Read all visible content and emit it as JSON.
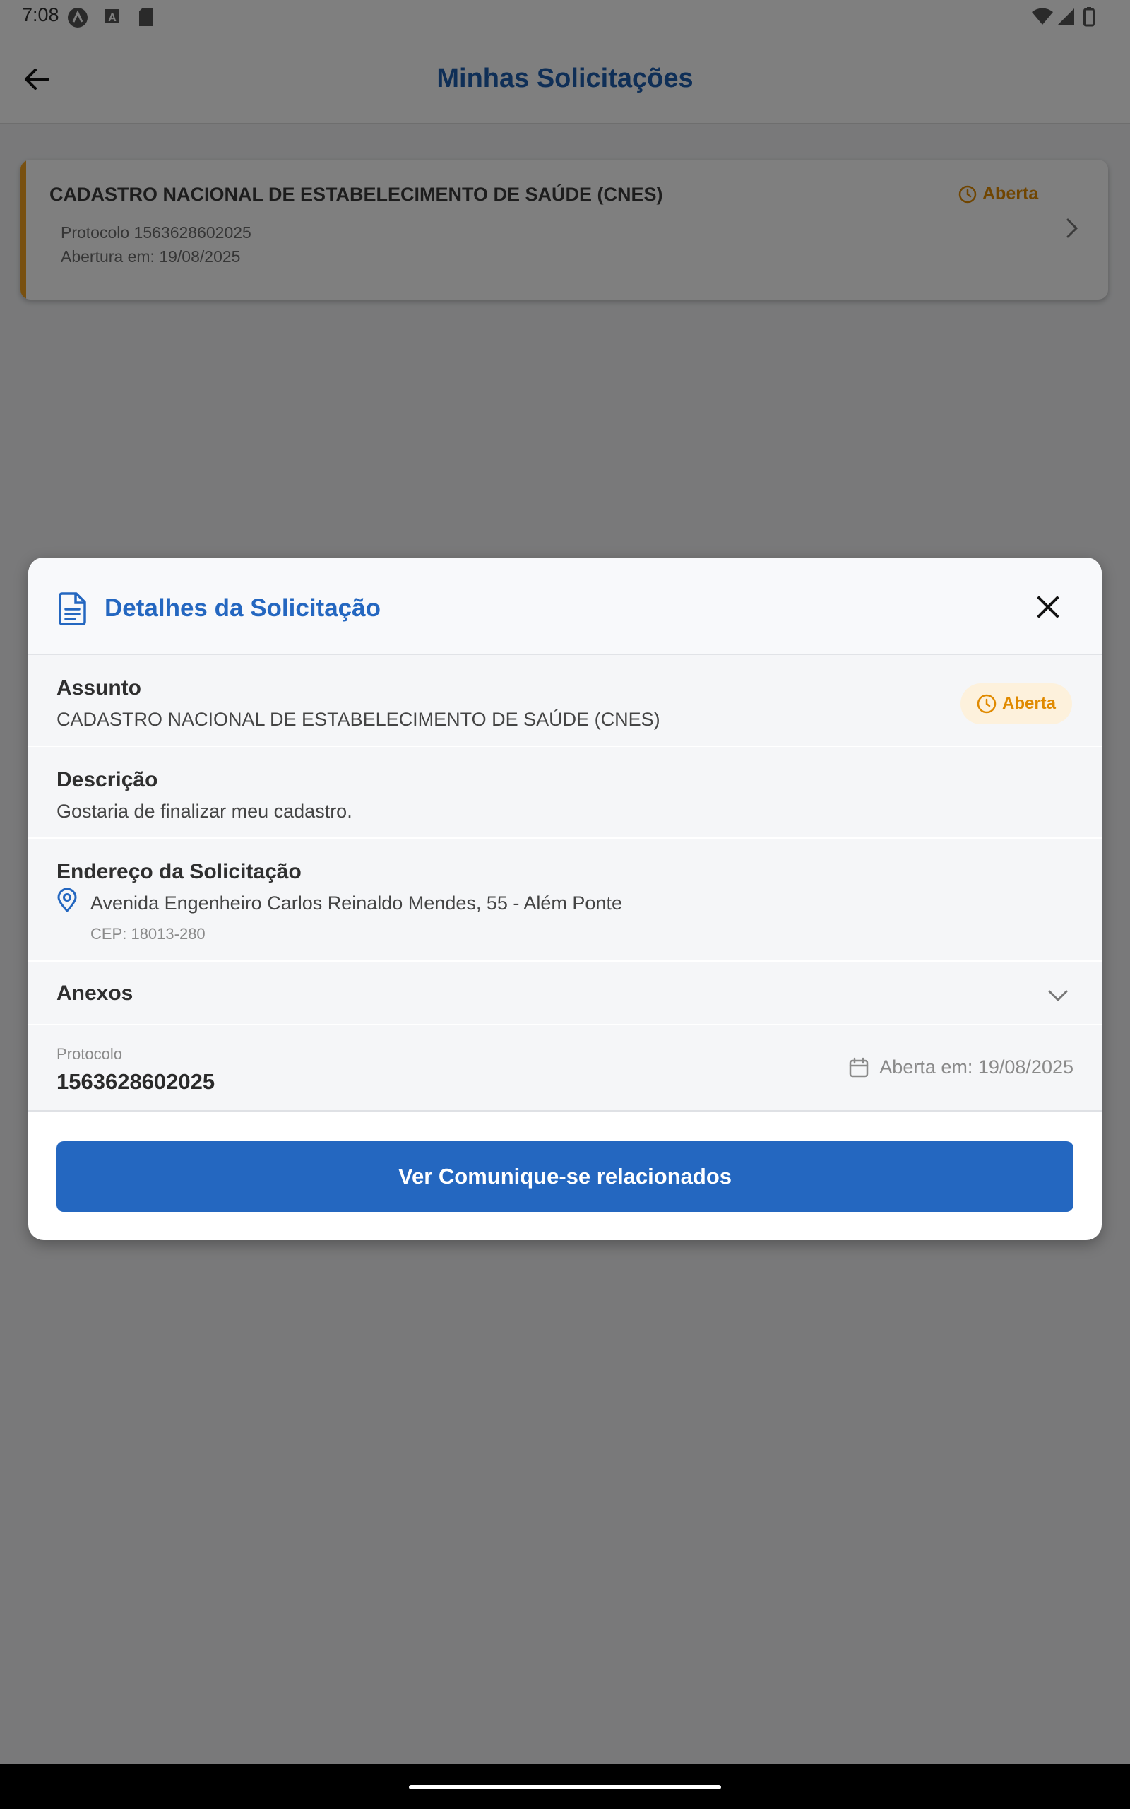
{
  "status_bar": {
    "time": "7:08"
  },
  "app_bar": {
    "title": "Minhas Solicitações"
  },
  "request_card": {
    "title": "CADASTRO NACIONAL DE ESTABELECIMENTO DE SAÚDE (CNES)",
    "protocol": "Protocolo 1563628602025",
    "opened": "Abertura em: 19/08/2025",
    "status": "Aberta"
  },
  "modal": {
    "title": "Detalhes da Solicitação",
    "subject_label": "Assunto",
    "subject_value": "CADASTRO NACIONAL DE ESTABELECIMENTO DE SAÚDE (CNES)",
    "status_badge": "Aberta",
    "description_label": "Descrição",
    "description_value": "Gostaria de finalizar meu cadastro.",
    "address_label": "Endereço da Solicitação",
    "address_value": "Avenida Engenheiro Carlos Reinaldo Mendes, 55 - Além Ponte",
    "cep": "CEP: 18013-280",
    "attachments_label": "Anexos",
    "protocol_label": "Protocolo",
    "protocol_value": "1563628602025",
    "opened_date": "Aberta em: 19/08/2025",
    "cta_label": "Ver Comunique-se relacionados"
  },
  "colors": {
    "primary": "#2467c0",
    "status_open": "#e08a00",
    "status_open_bg": "#fdf1dc",
    "card_accent": "#f0a020"
  }
}
